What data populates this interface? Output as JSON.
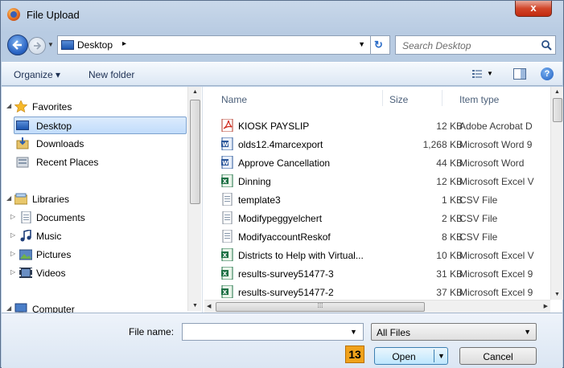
{
  "window": {
    "title": "File Upload",
    "close_label": "x"
  },
  "address": {
    "location": "Desktop",
    "separator": "▸",
    "search_placeholder": "Search Desktop"
  },
  "toolbar": {
    "organize_label": "Organize ▾",
    "new_folder_label": "New folder",
    "help_label": "?"
  },
  "nav": {
    "items": [
      {
        "label": "Favorites",
        "kind": "group",
        "icon": "star-icon"
      },
      {
        "label": "Desktop",
        "kind": "item",
        "icon": "desktop-icon",
        "selected": true
      },
      {
        "label": "Downloads",
        "kind": "item",
        "icon": "downloads-icon"
      },
      {
        "label": "Recent Places",
        "kind": "item",
        "icon": "recent-places-icon"
      },
      {
        "label": "Libraries",
        "kind": "group",
        "icon": "libraries-icon"
      },
      {
        "label": "Documents",
        "kind": "item",
        "icon": "documents-icon"
      },
      {
        "label": "Music",
        "kind": "item",
        "icon": "music-icon"
      },
      {
        "label": "Pictures",
        "kind": "item",
        "icon": "pictures-icon"
      },
      {
        "label": "Videos",
        "kind": "item",
        "icon": "videos-icon"
      },
      {
        "label": "Computer",
        "kind": "group",
        "icon": "computer-icon"
      }
    ]
  },
  "files": {
    "columns": {
      "name": "Name",
      "size": "Size",
      "type": "Item type"
    },
    "rows": [
      {
        "name": "KIOSK PAYSLIP",
        "size": "12 KB",
        "type": "Adobe Acrobat D",
        "icon": "pdf-icon"
      },
      {
        "name": "olds12.4marcexport",
        "size": "1,268 KB",
        "type": "Microsoft Word 9",
        "icon": "word-icon"
      },
      {
        "name": "Approve Cancellation",
        "size": "44 KB",
        "type": "Microsoft Word",
        "icon": "word-icon"
      },
      {
        "name": "Dinning",
        "size": "12 KB",
        "type": "Microsoft Excel V",
        "icon": "excel-icon"
      },
      {
        "name": "template3",
        "size": "1 KB",
        "type": "CSV File",
        "icon": "csv-icon"
      },
      {
        "name": "Modifypeggyelchert",
        "size": "2 KB",
        "type": "CSV File",
        "icon": "csv-icon"
      },
      {
        "name": "ModifyaccountReskof",
        "size": "8 KB",
        "type": "CSV File",
        "icon": "csv-icon"
      },
      {
        "name": "Districts to Help with Virtual...",
        "size": "10 KB",
        "type": "Microsoft Excel V",
        "icon": "excel-icon"
      },
      {
        "name": "results-survey51477-3",
        "size": "31 KB",
        "type": "Microsoft Excel 9",
        "icon": "excel-icon"
      },
      {
        "name": "results-survey51477-2",
        "size": "37 KB",
        "type": "Microsoft Excel 9",
        "icon": "excel-icon"
      }
    ]
  },
  "footer": {
    "filename_label": "File name:",
    "filename_value": "",
    "filetype_value": "All Files",
    "step_badge": "13",
    "open_label": "Open",
    "cancel_label": "Cancel"
  }
}
